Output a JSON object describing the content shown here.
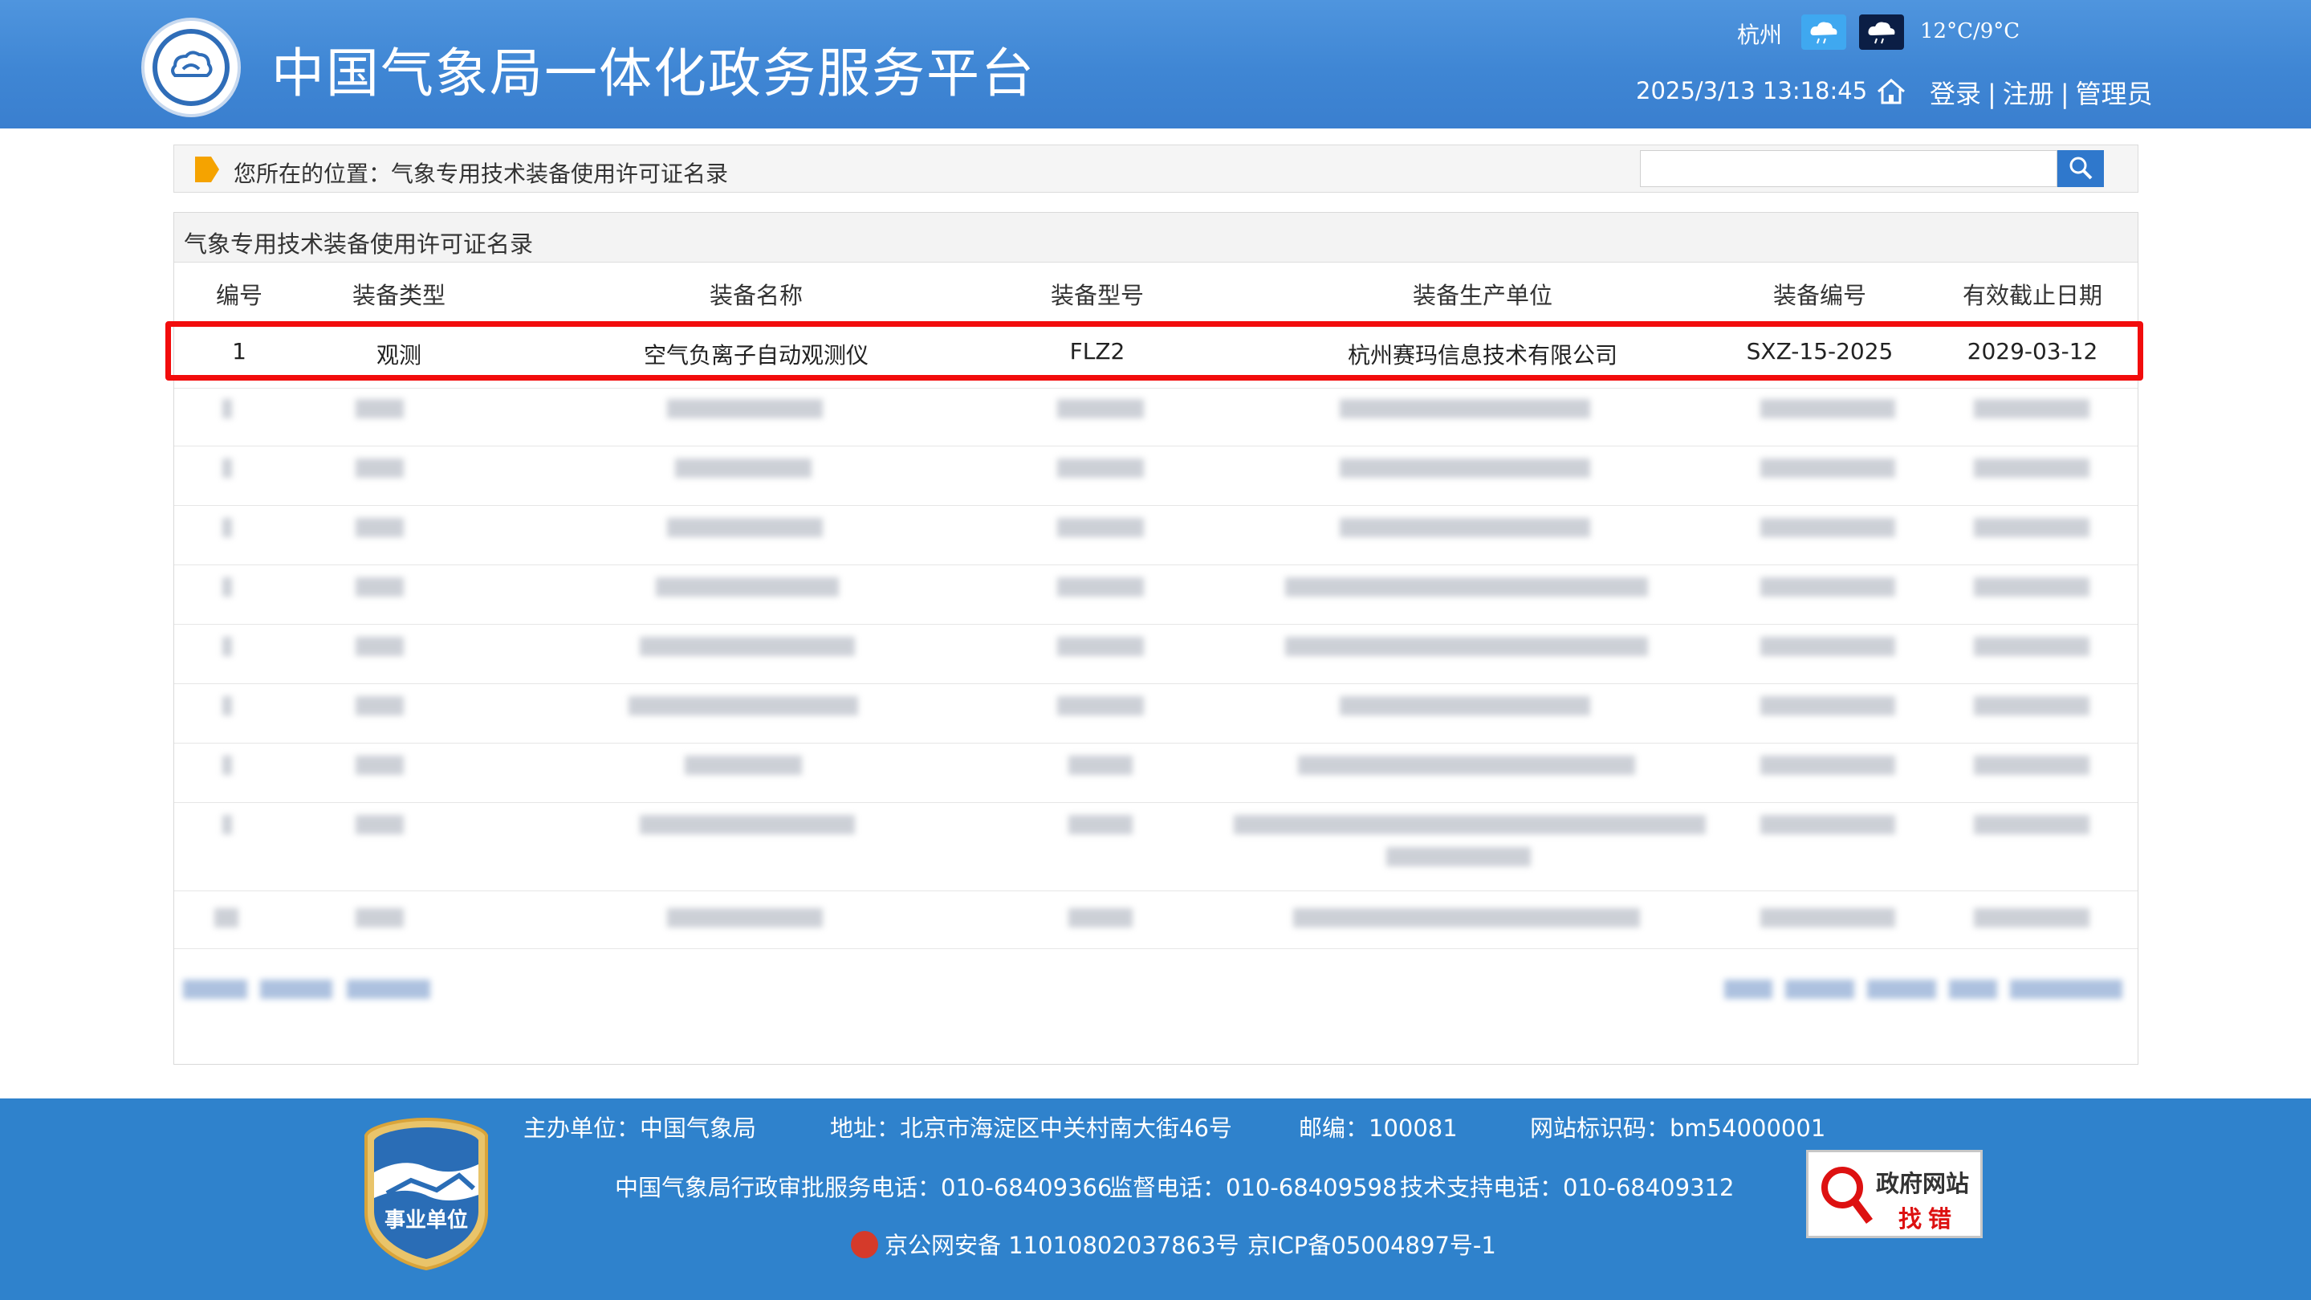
{
  "header": {
    "site_title": "中国气象局一体化政务服务平台",
    "city": "杭州",
    "temperature": "12°C/9°C",
    "datetime": "2025/3/13 13:18:45",
    "login": "登录",
    "register": "注册",
    "admin": "管理员",
    "separator": "|"
  },
  "breadcrumb": {
    "label": "您所在的位置：",
    "current": "气象专用技术装备使用许可证名录"
  },
  "search": {
    "placeholder": "",
    "value": ""
  },
  "panel": {
    "title": "气象专用技术装备使用许可证名录",
    "columns": [
      "编号",
      "装备类型",
      "装备名称",
      "装备型号",
      "装备生产单位",
      "装备编号",
      "有效截止日期"
    ],
    "first_row": {
      "no": "1",
      "type": "观测",
      "name": "空气负离子自动观测仪",
      "model": "FLZ2",
      "maker": "杭州赛玛信息技术有限公司",
      "code": "SXZ-15-2025",
      "expiry": "2029-03-12"
    }
  },
  "footer": {
    "host": "主办单位：中国气象局",
    "address": "地址：北京市海淀区中关村南大街46号",
    "postcode": "邮编：100081",
    "site_id": "网站标识码：bm54000001",
    "service_phone": "中国气象局行政审批服务电话：010-68409366",
    "supervise_phone": "监督电话：010-68409598",
    "support_phone": "技术支持电话：010-68409312",
    "police_record": "京公网安备 11010802037863号",
    "icp": "京ICP备05004897号-1",
    "badge_text": "事业单位",
    "error_site_line1": "政府网站",
    "error_site_line2": "找错"
  },
  "colors": {
    "header_blue": "#3f86d4",
    "footer_blue": "#2f82cc",
    "highlight_red": "#f20c0c",
    "search_button": "#2f78cc"
  },
  "icons": [
    "cma-logo",
    "rain-day-icon",
    "rain-night-icon",
    "home-icon",
    "search-icon",
    "breadcrumb-flag-icon",
    "police-emblem-icon",
    "public-institution-badge",
    "magnifier-icon"
  ]
}
